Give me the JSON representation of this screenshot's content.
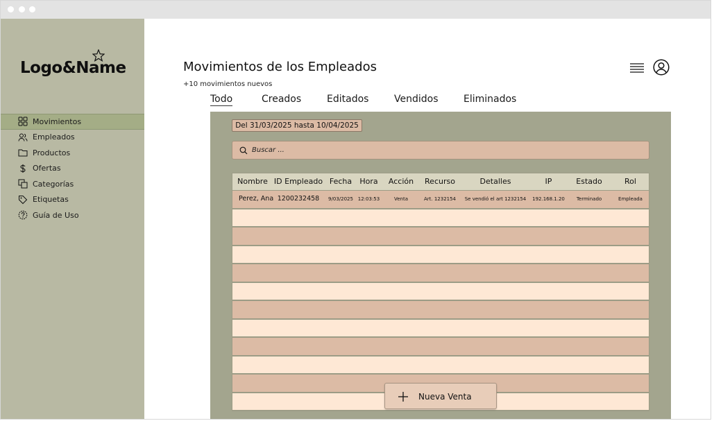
{
  "brand": {
    "logo_text": "Logo&Name"
  },
  "sidebar": {
    "items": [
      {
        "label": "Movimientos",
        "icon": "grid-icon",
        "active": true
      },
      {
        "label": "Empleados",
        "icon": "users-icon",
        "active": false
      },
      {
        "label": "Productos",
        "icon": "folder-icon",
        "active": false
      },
      {
        "label": "Ofertas",
        "icon": "dollar-icon",
        "active": false
      },
      {
        "label": "Categorías",
        "icon": "copy-icon",
        "active": false
      },
      {
        "label": "Etiquetas",
        "icon": "tag-icon",
        "active": false
      },
      {
        "label": "Guía de Uso",
        "icon": "help-icon",
        "active": false
      }
    ]
  },
  "header": {
    "title": "Movimientos de los Empleados",
    "subtitle": "+10 movimientos nuevos"
  },
  "tabs": [
    {
      "label": "Todo",
      "active": true
    },
    {
      "label": "Creados",
      "active": false
    },
    {
      "label": "Editados",
      "active": false
    },
    {
      "label": "Vendidos",
      "active": false
    },
    {
      "label": "Eliminados",
      "active": false
    }
  ],
  "filter": {
    "date_range": "Del 31/03/2025 hasta 10/04/2025"
  },
  "search": {
    "placeholder": "Buscar ..."
  },
  "table": {
    "columns": [
      "Nombre",
      "ID Empleado",
      "Fecha",
      "Hora",
      "Acción",
      "Recurso",
      "Detalles",
      "IP",
      "Estado",
      "Rol"
    ],
    "rows": [
      [
        "Perez, Ana",
        "1200232458",
        "9/03/2025",
        "12:03:53",
        "Venta",
        "Art. 1232154",
        "Se vendió el art 1232154",
        "192.168.1.20",
        "Terminado",
        "Empleada"
      ]
    ],
    "empty_rows": 11
  },
  "actions": {
    "new_sale_label": "Nueva Venta"
  },
  "colors": {
    "sidebar_bg": "#b8b9a3",
    "sidebar_active": "#a4ad86",
    "panel_bg": "#a3a58e",
    "row_dark": "#dcbba5",
    "row_light": "#fee8d5",
    "header_bg": "#d9d6c1"
  }
}
